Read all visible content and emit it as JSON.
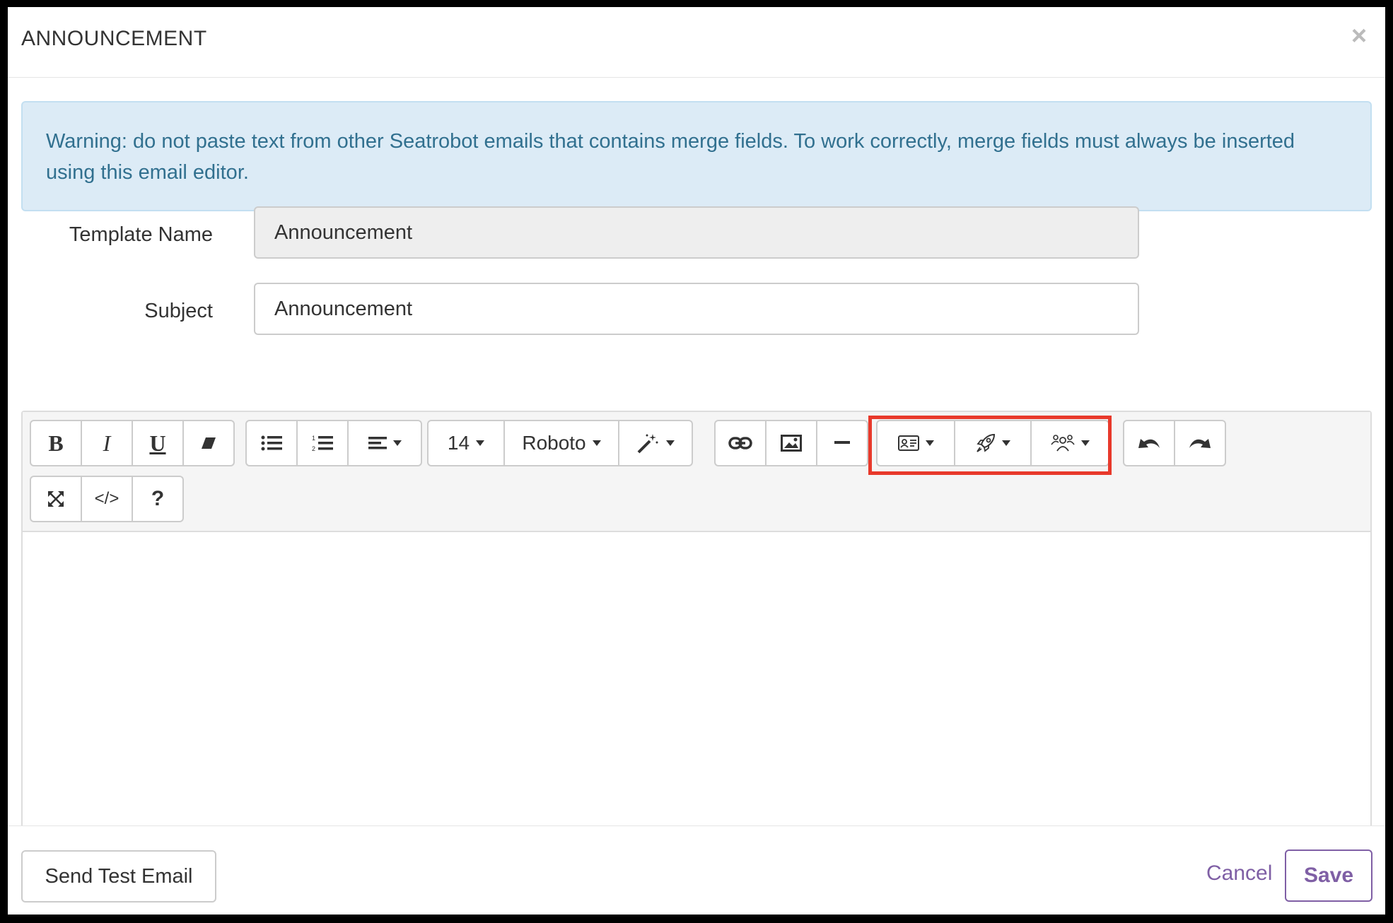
{
  "modal": {
    "title": "ANNOUNCEMENT",
    "close_glyph": "×"
  },
  "alert": {
    "text": "Warning: do not paste text from other Seatrobot emails that contains merge fields. To work correctly, merge fields must always be inserted using this email editor."
  },
  "form": {
    "template_name_label": "Template Name",
    "template_name_value": "Announcement",
    "subject_label": "Subject",
    "subject_value": "Announcement"
  },
  "toolbar": {
    "bold": "B",
    "italic": "I",
    "underline": "U",
    "font_size": "14",
    "font_family": "Roboto",
    "help": "?",
    "code_view": "</>",
    "icons": [
      "bold-icon",
      "italic-icon",
      "underline-icon",
      "eraser-icon",
      "unordered-list-icon",
      "ordered-list-icon",
      "align-icon",
      "magic-wand-icon",
      "link-icon",
      "image-icon",
      "horizontal-rule-icon",
      "contact-card-icon",
      "rocket-icon",
      "users-icon",
      "undo-icon",
      "redo-icon",
      "fullscreen-icon",
      "code-icon",
      "help-icon"
    ]
  },
  "footer": {
    "send_test_label": "Send Test Email",
    "cancel_label": "Cancel",
    "save_label": "Save"
  },
  "colors": {
    "accent": "#7f5fa5",
    "alert_bg": "#dcebf6",
    "alert_text": "#31708f",
    "highlight": "#e8392b"
  }
}
